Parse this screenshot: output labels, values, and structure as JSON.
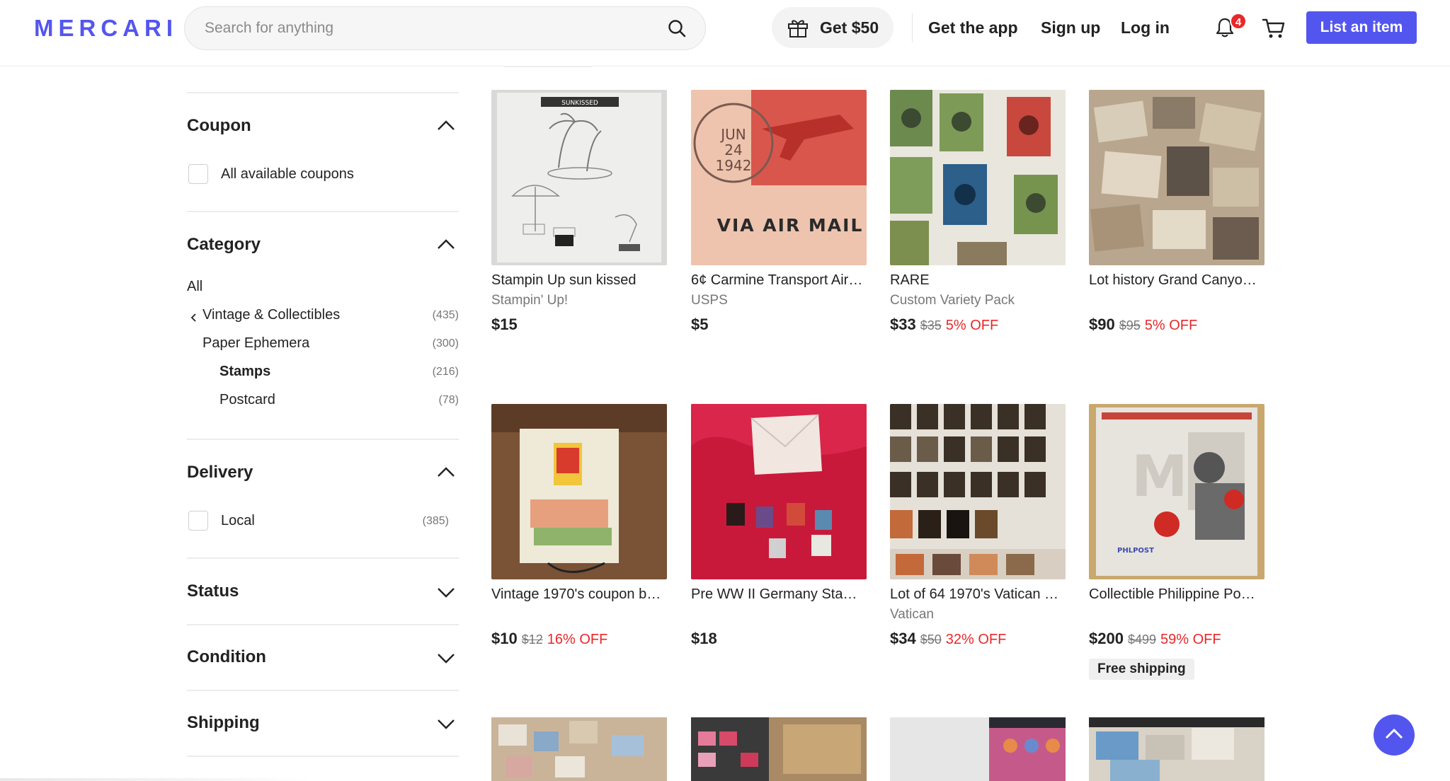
{
  "header": {
    "logo": "MERCARI",
    "search_placeholder": "Search for anything",
    "promo_label": "Get $50",
    "get_app": "Get the app",
    "sign_up": "Sign up",
    "log_in": "Log in",
    "notification_count": "4",
    "list_item": "List an item"
  },
  "sidebar": {
    "coupon": {
      "title": "Coupon",
      "option": "All available coupons"
    },
    "category": {
      "title": "Category",
      "items": [
        {
          "label": "All",
          "count": ""
        },
        {
          "label": "Vintage & Collectibles",
          "count": "(435)"
        },
        {
          "label": "Paper Ephemera",
          "count": "(300)"
        },
        {
          "label": "Stamps",
          "count": "(216)"
        },
        {
          "label": "Postcard",
          "count": "(78)"
        }
      ]
    },
    "delivery": {
      "title": "Delivery",
      "option": "Local",
      "count": "(385)"
    },
    "collapsed_sections": [
      "Status",
      "Condition",
      "Shipping"
    ]
  },
  "products": [
    {
      "title": "Stampin Up sun kissed",
      "brand": "Stampin' Up!",
      "price": "$15",
      "orig": "",
      "off": "",
      "icon": "stamp-sheet-image"
    },
    {
      "title": "6¢ Carmine Transport Air…",
      "brand": "USPS",
      "price": "$5",
      "orig": "",
      "off": "",
      "icon": "airmail-envelope-image"
    },
    {
      "title": "RARE",
      "brand": "Custom Variety Pack",
      "price": "$33",
      "orig": "$35",
      "off": "5% OFF",
      "icon": "stamp-collection-image"
    },
    {
      "title": "Lot history Grand Canyo…",
      "brand": "",
      "price": "$90",
      "orig": "$95",
      "off": "5% OFF",
      "icon": "photo-lot-image"
    },
    {
      "title": "Vintage 1970's coupon b…",
      "brand": "",
      "price": "$10",
      "orig": "$12",
      "off": "16% OFF",
      "icon": "saver-book-image"
    },
    {
      "title": "Pre WW II Germany Sta…",
      "brand": "",
      "price": "$18",
      "orig": "",
      "off": "",
      "icon": "stamps-on-red-image"
    },
    {
      "title": "Lot of 64 1970's Vatican …",
      "brand": "Vatican",
      "price": "$34",
      "orig": "$50",
      "off": "32% OFF",
      "icon": "vatican-stamps-image"
    },
    {
      "title": "Collectible Philippine Po…",
      "brand": "",
      "price": "$200",
      "orig": "$499",
      "off": "59% OFF",
      "badge": "Free shipping",
      "icon": "boxer-stamp-sheet-image"
    }
  ],
  "colors": {
    "brand": "#5356ee",
    "discount": "#e8282a",
    "muted": "#777777"
  }
}
